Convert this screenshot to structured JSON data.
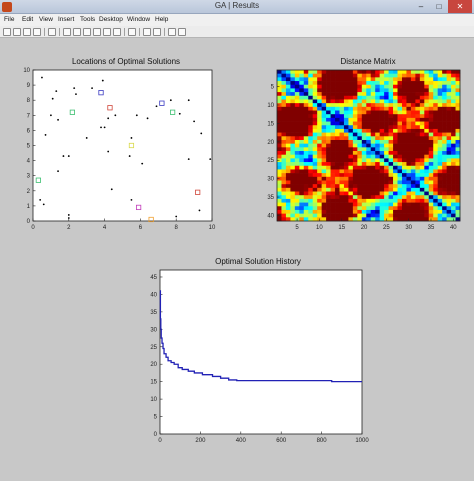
{
  "window": {
    "title": "GA | Results",
    "min_glyph": "–",
    "max_glyph": "□",
    "close_glyph": "✕"
  },
  "menu": {
    "items": [
      "File",
      "Edit",
      "View",
      "Insert",
      "Tools",
      "Desktop",
      "Window",
      "Help"
    ]
  },
  "toolbar": {
    "icons": [
      "new-file-icon",
      "open-folder-icon",
      "save-icon",
      "print-icon",
      "arrow-icon",
      "zoom-in-icon",
      "zoom-out-icon",
      "pan-icon",
      "rotate-icon",
      "data-cursor-icon",
      "brush-icon",
      "link-icon",
      "colorbar-icon",
      "legend-icon",
      "hide-plot-tools-icon",
      "show-plot-tools-icon"
    ]
  },
  "chart_data": [
    {
      "type": "scatter",
      "title": "Locations of Optimal Solutions",
      "xlim": [
        0,
        10
      ],
      "ylim": [
        0,
        10
      ],
      "xticks": [
        0,
        2,
        4,
        6,
        8,
        10
      ],
      "yticks": [
        0,
        1,
        2,
        3,
        4,
        5,
        6,
        7,
        8,
        9,
        10
      ],
      "points": [
        [
          0.5,
          9.5
        ],
        [
          1.1,
          8.1
        ],
        [
          1.3,
          8.6
        ],
        [
          2.3,
          8.8
        ],
        [
          3.3,
          8.8
        ],
        [
          3.9,
          9.3
        ],
        [
          0.7,
          5.7
        ],
        [
          1.0,
          7.0
        ],
        [
          1.4,
          6.7
        ],
        [
          3.0,
          5.5
        ],
        [
          3.8,
          6.2
        ],
        [
          4.0,
          6.2
        ],
        [
          4.2,
          6.8
        ],
        [
          4.6,
          7.0
        ],
        [
          5.5,
          5.5
        ],
        [
          5.8,
          7.0
        ],
        [
          6.4,
          6.8
        ],
        [
          6.9,
          7.6
        ],
        [
          7.7,
          8.0
        ],
        [
          8.2,
          7.1
        ],
        [
          8.7,
          8.0
        ],
        [
          9.0,
          6.6
        ],
        [
          9.4,
          5.8
        ],
        [
          1.7,
          4.3
        ],
        [
          2.0,
          4.3
        ],
        [
          4.2,
          4.6
        ],
        [
          5.4,
          4.3
        ],
        [
          6.1,
          3.8
        ],
        [
          8.7,
          4.1
        ],
        [
          4.4,
          2.1
        ],
        [
          5.5,
          1.4
        ],
        [
          0.4,
          1.4
        ],
        [
          0.6,
          1.1
        ],
        [
          2.0,
          0.4
        ],
        [
          2.0,
          0.2
        ],
        [
          8.0,
          0.3
        ],
        [
          9.3,
          0.7
        ],
        [
          9.9,
          4.1
        ],
        [
          2.4,
          8.4
        ],
        [
          1.4,
          3.3
        ]
      ],
      "markers": [
        {
          "x": 3.8,
          "y": 8.5,
          "color": "#3b3bc2"
        },
        {
          "x": 4.3,
          "y": 7.5,
          "color": "#d0463a"
        },
        {
          "x": 7.2,
          "y": 7.8,
          "color": "#3b3bc2"
        },
        {
          "x": 7.8,
          "y": 7.2,
          "color": "#3cbf70"
        },
        {
          "x": 2.2,
          "y": 7.2,
          "color": "#3cbf70"
        },
        {
          "x": 5.5,
          "y": 5.0,
          "color": "#d9d94a"
        },
        {
          "x": 0.3,
          "y": 2.7,
          "color": "#3cbf70"
        },
        {
          "x": 5.9,
          "y": 0.9,
          "color": "#c23dbb"
        },
        {
          "x": 6.6,
          "y": 0.1,
          "color": "#f0a030"
        },
        {
          "x": 9.2,
          "y": 1.9,
          "color": "#d0463a"
        }
      ]
    },
    {
      "type": "heatmap",
      "title": "Distance Matrix",
      "n": 41,
      "xticks": [
        5,
        10,
        15,
        20,
        25,
        30,
        35,
        40
      ],
      "yticks": [
        5,
        10,
        15,
        20,
        25,
        30,
        35,
        40
      ],
      "colormap": "jet"
    },
    {
      "type": "line",
      "title": "Optimal Solution History",
      "xlim": [
        0,
        1000
      ],
      "ylim": [
        0,
        47
      ],
      "xticks": [
        0,
        200,
        400,
        600,
        800,
        1000
      ],
      "yticks": [
        0,
        5,
        10,
        15,
        20,
        25,
        30,
        35,
        40,
        45
      ],
      "color": "#2121b5",
      "x": [
        0,
        2,
        4,
        6,
        10,
        15,
        20,
        30,
        40,
        55,
        70,
        90,
        110,
        140,
        170,
        210,
        260,
        300,
        340,
        380,
        420,
        500,
        620,
        700,
        820,
        850,
        1000
      ],
      "y": [
        41,
        33,
        30,
        27.5,
        26,
        24.5,
        23,
        22,
        21,
        20.5,
        20,
        19,
        18.5,
        18,
        17.5,
        17,
        16.5,
        16,
        15.5,
        15.3,
        15.3,
        15.3,
        15.3,
        15.3,
        15.3,
        15.0,
        15.0
      ]
    }
  ]
}
